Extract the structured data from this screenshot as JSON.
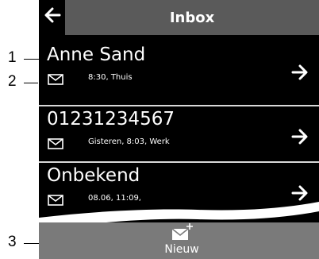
{
  "header": {
    "back_icon": "arrow-left-icon",
    "title": "Inbox"
  },
  "entries": [
    {
      "name": "Anne Sand",
      "meta": "8:30, Thuis",
      "icon": "envelope-icon",
      "action_icon": "arrow-right-icon"
    },
    {
      "name": "01231234567",
      "meta": "Gisteren, 8:03, Werk",
      "icon": "envelope-icon",
      "action_icon": "arrow-right-icon"
    },
    {
      "name": "Onbekend",
      "meta": "08.06, 11:09,",
      "icon": "envelope-icon",
      "action_icon": "arrow-right-icon"
    }
  ],
  "bottom": {
    "new_label": "Nieuw",
    "new_icon": "new-message-icon"
  },
  "callouts": [
    "1",
    "2",
    "3"
  ],
  "colors": {
    "screen_bg": "#000000",
    "title_bar": "#5a5a5a",
    "bottom_bar": "#7a7a7a",
    "divider": "#d8d8d8",
    "text": "#ffffff"
  }
}
